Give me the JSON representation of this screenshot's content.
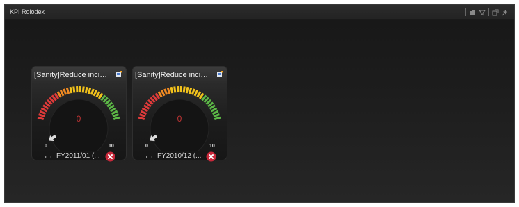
{
  "panel": {
    "title": "KPI Rolodex"
  },
  "cards": [
    {
      "title": "[Sanity]Reduce incide...",
      "value": "0",
      "min": "0",
      "max": "10",
      "period": "FY2011/01 (..."
    },
    {
      "title": "[Sanity]Reduce incide...",
      "value": "0",
      "min": "0",
      "max": "10",
      "period": "FY2010/12 (..."
    }
  ],
  "colors": {
    "red": "#e03a3a",
    "orange": "#f08a22",
    "yellow": "#f2c21b",
    "green": "#5cb846",
    "status_red": "#c8283a"
  },
  "icons": [
    "folder-icon",
    "filter-icon",
    "popout-icon",
    "pin-icon",
    "note-icon",
    "arrow-icon",
    "close-circle-icon"
  ]
}
